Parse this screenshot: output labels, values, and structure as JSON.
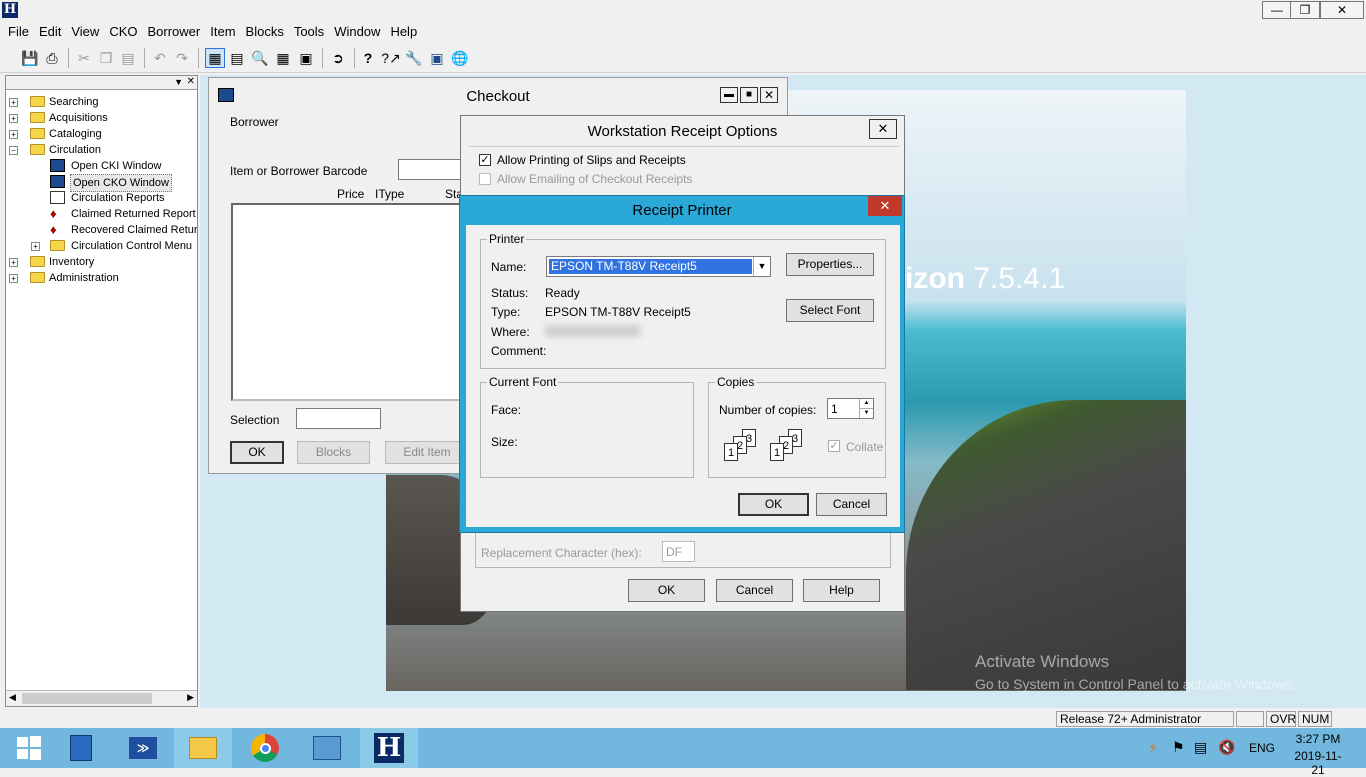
{
  "app": {
    "title_logo": "H"
  },
  "menu": [
    "File",
    "Edit",
    "View",
    "CKO",
    "Borrower",
    "Item",
    "Blocks",
    "Tools",
    "Window",
    "Help"
  ],
  "tree": {
    "items": [
      {
        "label": "Searching"
      },
      {
        "label": "Acquisitions"
      },
      {
        "label": "Cataloging"
      },
      {
        "label": "Circulation"
      },
      {
        "label": "Open CKI Window"
      },
      {
        "label": "Open CKO Window"
      },
      {
        "label": "Circulation Reports"
      },
      {
        "label": "Claimed Returned Report"
      },
      {
        "label": "Recovered Claimed Returns"
      },
      {
        "label": "Circulation Control Menu"
      },
      {
        "label": "Inventory"
      },
      {
        "label": "Administration"
      }
    ]
  },
  "checkout": {
    "title": "Checkout",
    "borrower_label": "Borrower",
    "barcode_label": "Item or Borrower Barcode",
    "col_price": "Price",
    "col_itype": "IType",
    "col_status": "Sta",
    "selection_label": "Selection",
    "ok": "OK",
    "blocks": "Blocks",
    "edit_item": "Edit Item"
  },
  "receipt_options": {
    "title": "Workstation Receipt Options",
    "allow_printing": "Allow Printing of Slips and Receipts",
    "allow_printing_checked": true,
    "allow_emailing": "Allow Emailing of Checkout Receipts",
    "replacement_label": "Replacement Character (hex):",
    "replacement_value": "DF",
    "ok": "OK",
    "cancel": "Cancel",
    "help": "Help"
  },
  "receipt_printer": {
    "title": "Receipt Printer",
    "printer_group": "Printer",
    "name_label": "Name:",
    "name_value": "EPSON TM-T88V Receipt5",
    "properties": "Properties...",
    "status_label": "Status:",
    "status_value": "Ready",
    "type_label": "Type:",
    "type_value": "EPSON TM-T88V Receipt5",
    "where_label": "Where:",
    "comment_label": "Comment:",
    "select_font": "Select Font",
    "current_font_group": "Current Font",
    "face_label": "Face:",
    "size_label": "Size:",
    "copies_group": "Copies",
    "copies_label": "Number of copies:",
    "copies_value": "1",
    "collate": "Collate",
    "collate_checked": true,
    "ok": "OK",
    "cancel": "Cancel"
  },
  "desktop": {
    "brand": "izon",
    "version": "7.5.4.1",
    "activate_line1": "Activate Windows",
    "activate_line2": "Go to System in Control Panel to activate Windows."
  },
  "statusbar": {
    "release": "Release 72+ Administrator",
    "ovr": "OVR",
    "num": "NUM"
  },
  "taskbar": {
    "lang": "ENG",
    "time": "3:27 PM",
    "date": "2019-11-21"
  },
  "colors": {
    "dialog_border": "#2aa8d8",
    "close_red": "#c0392b",
    "taskbar": "#72b8de",
    "selection": "#3072e0"
  }
}
